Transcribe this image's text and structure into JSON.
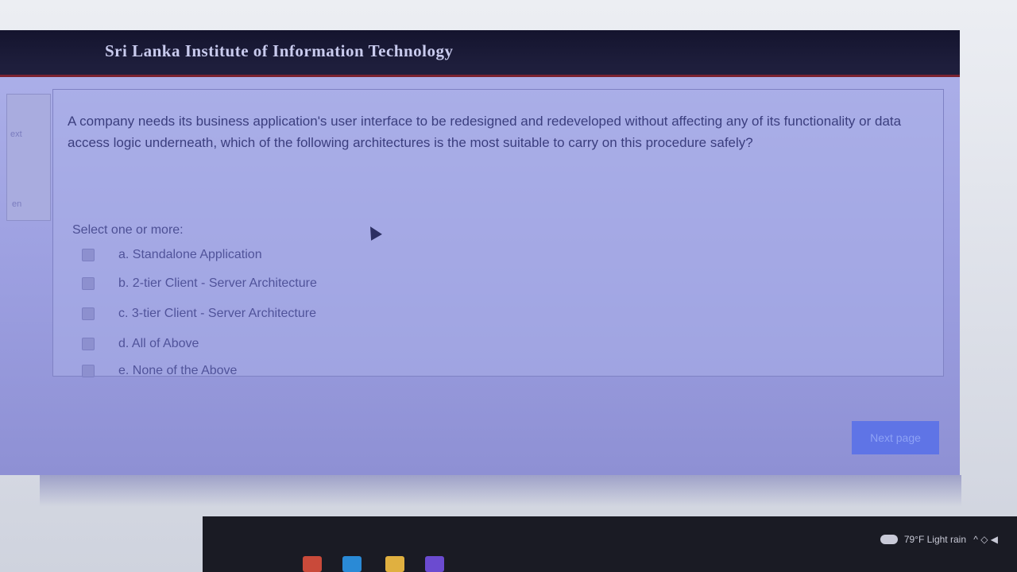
{
  "header": {
    "title": "Sri Lanka Institute of Information Technology"
  },
  "left_panel": {
    "text_top": "ext",
    "text_bottom": "en"
  },
  "question": {
    "text": "A company needs its business application's user interface to be redesigned and redeveloped without affecting any of its functionality or data access logic underneath, which of the following architectures is the most suitable to carry on this procedure safely?",
    "prompt": "Select one or more:",
    "options": [
      {
        "label": "a. Standalone Application"
      },
      {
        "label": "b. 2-tier Client - Server Architecture"
      },
      {
        "label": "c. 3-tier Client - Server Architecture"
      },
      {
        "label": "d. All of Above"
      },
      {
        "label": "e. None of the Above"
      }
    ]
  },
  "navigation": {
    "next_label": "Next page"
  },
  "taskbar": {
    "weather": "79°F  Light rain",
    "tray": "^ ◇ ◀"
  },
  "colors": {
    "header_bg": "#14142e",
    "accent_bar": "#7a2230",
    "next_button": "#5f74e6"
  }
}
